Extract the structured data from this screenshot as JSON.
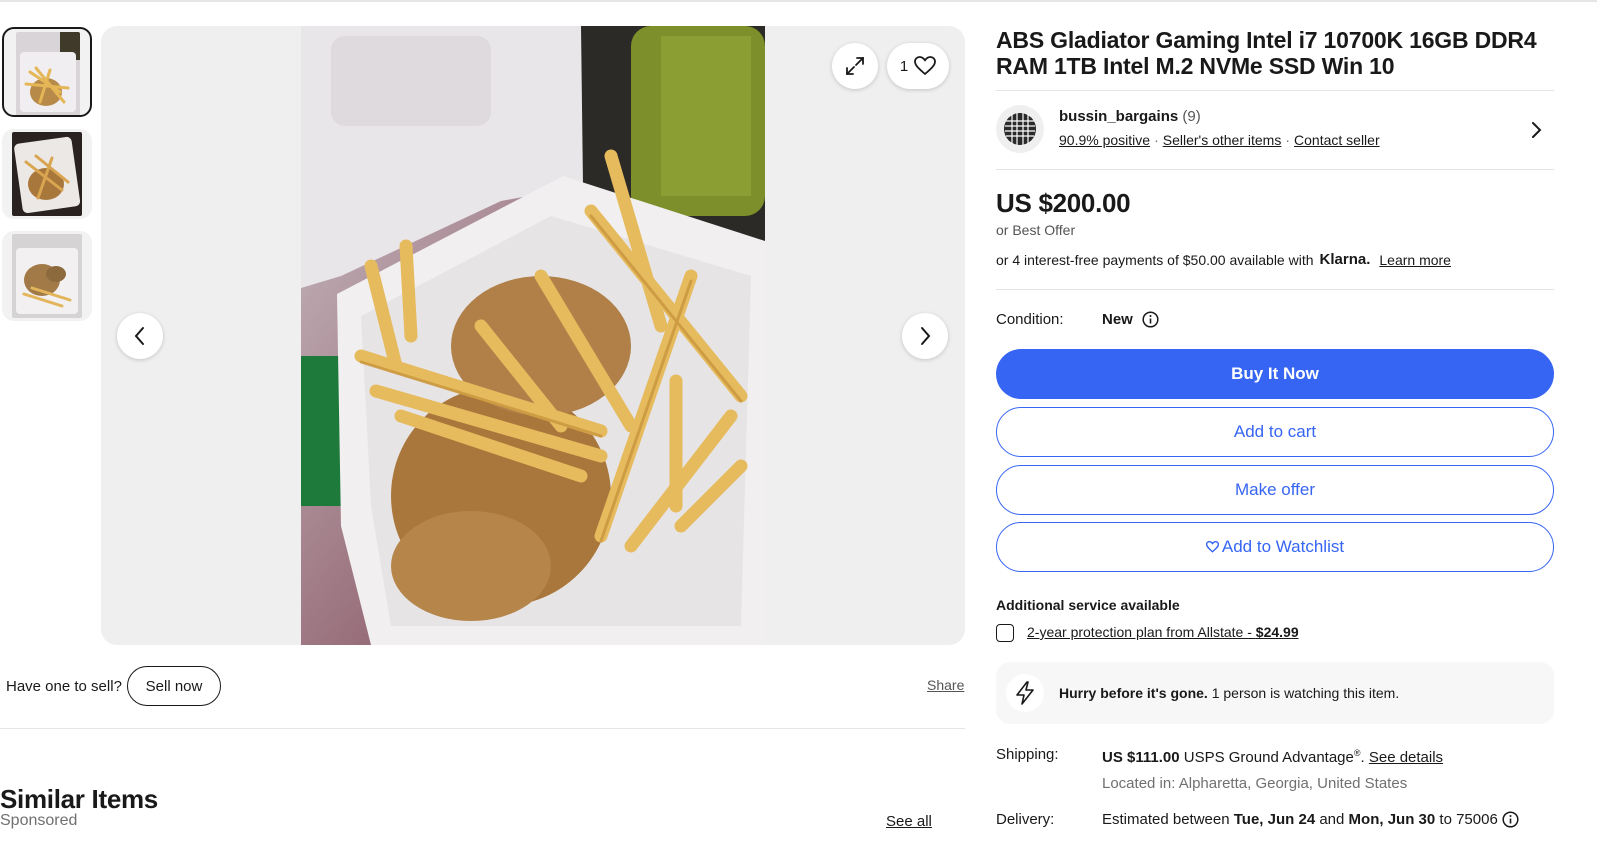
{
  "gallery": {
    "thumbnails": [
      "thumb-1",
      "thumb-2",
      "thumb-3"
    ],
    "selected_index": 0,
    "watch_count": "1"
  },
  "sell": {
    "prompt": "Have one to sell?",
    "button": "Sell now",
    "share": "Share"
  },
  "similar": {
    "title": "Similar Items",
    "sponsored": "Sponsored",
    "see_all": "See all"
  },
  "listing": {
    "title": "ABS Gladiator Gaming Intel i7 10700K 16GB DDR4 RAM 1TB Intel M.2 NVMe SSD Win 10",
    "seller": {
      "name": "bussin_bargains",
      "feedback_count": "(9)",
      "positive": "90.9% positive",
      "other_items": "Seller's other items",
      "contact": "Contact seller"
    },
    "price": "US $200.00",
    "best_offer": "or Best Offer",
    "installments": "or 4 interest-free payments of $50.00 available with",
    "klarna": "Klarna.",
    "learn_more": "Learn more",
    "condition_label": "Condition:",
    "condition_value": "New",
    "buttons": {
      "buy_now": "Buy It Now",
      "add_to_cart": "Add to cart",
      "make_offer": "Make offer",
      "watchlist": "Add to Watchlist"
    },
    "additional_service": "Additional service available",
    "protection_plan_text": "2-year protection plan from Allstate - ",
    "protection_plan_price": "$24.99",
    "hurry_bold": "Hurry before it's gone.",
    "hurry_rest": " 1 person is watching this item.",
    "shipping_label": "Shipping:",
    "shipping_price": "US $111.00",
    "shipping_service": " USPS Ground Advantage",
    "shipping_reg": "®",
    "shipping_sep": ".",
    "see_details": "See details",
    "location": "Located in: Alpharetta, Georgia, United States",
    "delivery_label": "Delivery:",
    "delivery_prefix": "Estimated between ",
    "delivery_start": "Tue, Jun 24",
    "delivery_and": " and ",
    "delivery_end": "Mon, Jun 30",
    "delivery_suffix": " to 75006"
  },
  "colors": {
    "accent": "#3665f3",
    "text": "#191919",
    "muted": "#707070"
  }
}
